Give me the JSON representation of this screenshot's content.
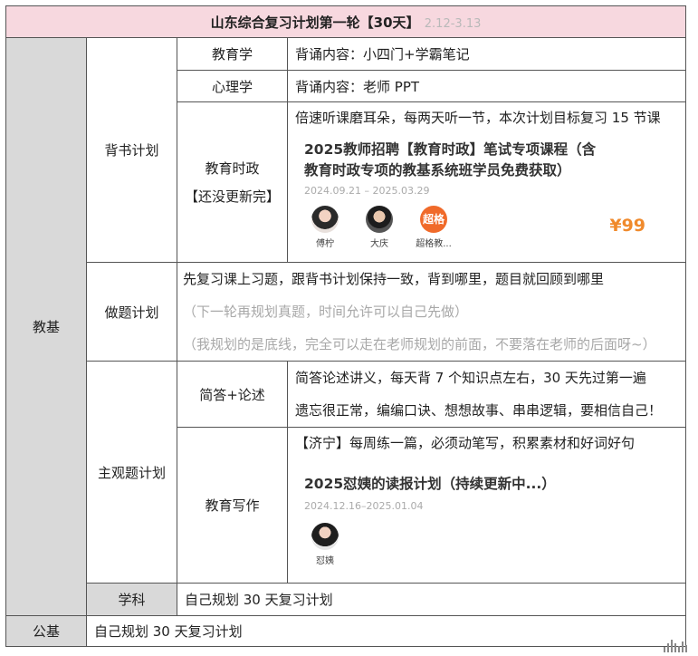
{
  "title": {
    "main": "山东综合复习计划第一轮【30天】",
    "date": "2.12-3.13"
  },
  "sections": {
    "jiaoji": "教基",
    "xueke": "学科",
    "gongji": "公基"
  },
  "beishu": {
    "label": "背书计划",
    "jiaoyuxue": {
      "label": "教育学",
      "content": "背诵内容：小四门+学霸笔记"
    },
    "xinlixue": {
      "label": "心理学",
      "content": "背诵内容：老师 PPT"
    },
    "shizheng": {
      "label_line1": "教育时政",
      "label_line2": "【还没更新完】",
      "content": "倍速听课磨耳朵，每两天听一节，本次计划目标复习 15 节课",
      "course": {
        "title_line1": "2025教师招聘【教育时政】笔试专项课程（含",
        "title_line2": "教育时政专项的教基系统班学员免费获取）",
        "date": "2024.09.21 – 2025.03.29",
        "teachers": [
          "傅柠",
          "大庆",
          "超格教..."
        ],
        "badge": "超格",
        "price": "¥99"
      }
    }
  },
  "zuoti": {
    "label": "做题计划",
    "line1": "先复习课上习题，跟背书计划保持一致，背到哪里，题目就回顾到哪里",
    "line2": "（下一轮再规划真题，时间允许可以自己先做）",
    "line3": "（我规划的是底线，完全可以走在老师规划的前面，不要落在老师的后面呀~）"
  },
  "zhuguan": {
    "label": "主观题计划",
    "jianda": {
      "label": "简答+论述",
      "line1": "简答论述讲义，每天背 7 个知识点左右，30 天先过第一遍",
      "line2": "遗忘很正常，编编口诀、想想故事、串串逻辑，要相信自己！"
    },
    "xiezuo": {
      "label": "教育写作",
      "content": "【济宁】每周练一篇，必须动笔写，积累素材和好词好句",
      "course": {
        "title": "2025怼姨的读报计划（持续更新中...）",
        "date": "2024.12.16–2025.01.04",
        "teacher": "怼姨"
      }
    }
  },
  "xueke_plan": "自己规划 30 天复习计划",
  "gongji_plan": "自己规划 30 天复习计划",
  "colors": {
    "header_bg": "#f7d8df",
    "side_bg": "#d9d9d9",
    "price": "#f08a2c",
    "badge": "#f06a2a"
  }
}
